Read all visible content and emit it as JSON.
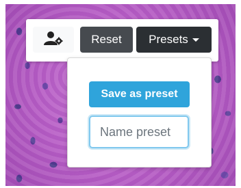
{
  "toolbar": {
    "user_settings_icon": "user-gear-icon",
    "reset_label": "Reset",
    "presets_label": "Presets"
  },
  "presets_dropdown": {
    "save_label": "Save as preset",
    "name_input": {
      "value": "",
      "placeholder": "Name preset"
    }
  },
  "colors": {
    "save_button": "#2fa4db",
    "reset_button": "#464a4f",
    "presets_button": "#2b2f33",
    "input_focus": "#80c8ee"
  }
}
